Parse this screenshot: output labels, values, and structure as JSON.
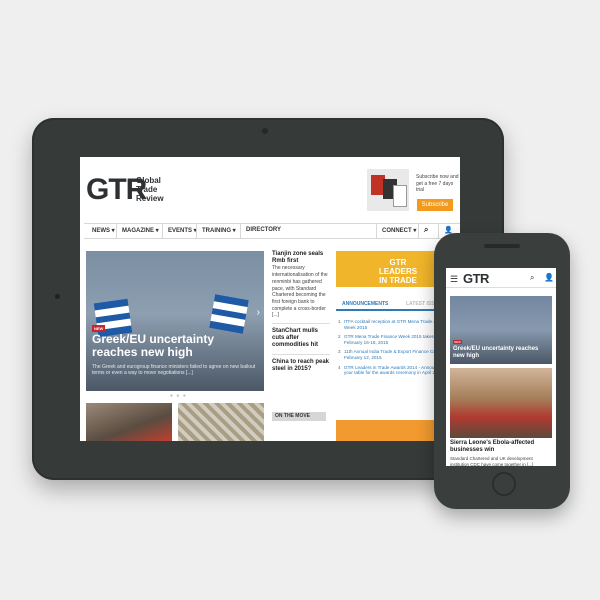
{
  "tablet": {
    "logo": "GTR",
    "logo_sub": "Global\nTrade\nReview",
    "subscribe_text": "Subscribe now and get a free 7 days trial",
    "subscribe_button": "Subscribe",
    "nav": [
      "NEWS ▾",
      "MAGAZINE ▾",
      "EVENTS ▾",
      "TRAINING ▾",
      "DIRECTORY",
      "CONNECT ▾"
    ],
    "hero": {
      "badge": "NEW",
      "title": "Greek/EU uncertainty reaches new high",
      "text": "The Greek and eurogroup finance ministers failed to agree on new bailout terms or even a way to move negotiations [...]"
    },
    "side_stories": [
      {
        "headline": "Tianjin zone seals Rmb first",
        "text": "The necessary internationalisation of the renminbi has gathered pace, with Standard Chartered becoming the first foreign bank to complete a cross-border [...]"
      },
      {
        "headline": "StanChart mulls cuts after commodities hit",
        "text": ""
      },
      {
        "headline": "China to reach peak steel in 2015?",
        "text": ""
      }
    ],
    "on_the_move": "ON THE MOVE",
    "banner": "GTR\nLEADERS\nIN TRADE",
    "tabs": {
      "active": "ANNOUNCEMENTS",
      "inactive": "LATEST ISSUE"
    },
    "announcements": [
      "ITFA cocktail reception at GTR Mena Trade & Finance Week 2015",
      "GTR Mena Trade Finance Week 2015 takes place on February 16-18, 2015",
      "11th Annual India Trade & Export Finance Conference – February 12, 2015",
      "GTR Leaders in Trade Awards 2014 - Announced! Book your table for the awards ceremony in April 2015"
    ]
  },
  "phone": {
    "logo": "GTR",
    "hero_badge": "NEW",
    "hero_title": "Greek/EU uncertainty reaches new high",
    "headline": "Sierra Leone's Ebola-affected businesses win",
    "text": "Standard Chartered and UK development institution CDC have come together in [...]"
  }
}
